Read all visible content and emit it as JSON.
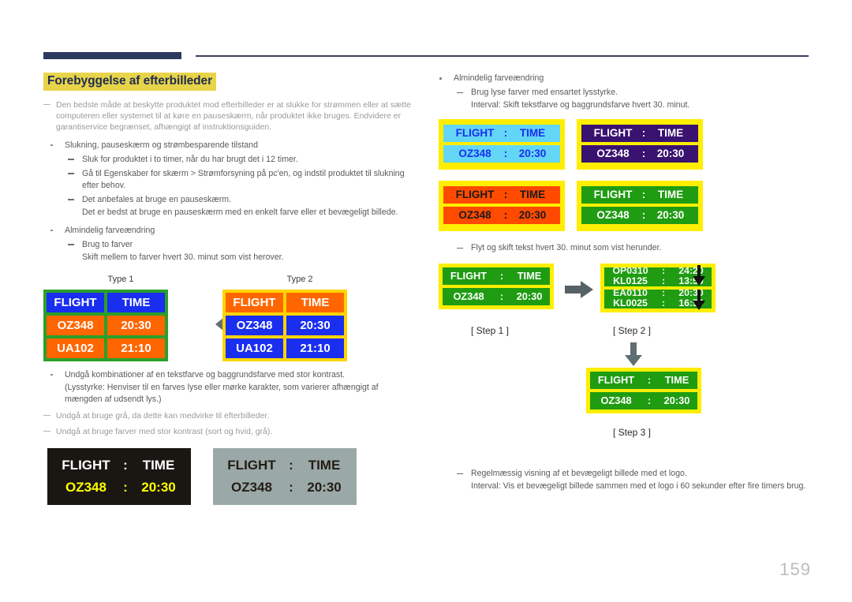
{
  "page": {
    "number": "159",
    "accent_navy": "#2b3a5c",
    "highlight_yellow": "#e8d44a"
  },
  "section": {
    "title": "Forebyggelse af efterbilleder"
  },
  "left": {
    "intro_note": "Den bedste måde at beskytte produktet mod efterbilleder er at slukke for strømmen eller at sætte computeren eller systemet til at køre en pauseskærm, når produktet ikke bruges. Endvidere er garantiservice begrænset, afhængigt af instruktionsguiden.",
    "bullet1": "Slukning, pauseskærm og strømbesparende tilstand",
    "sub1": "Sluk for produktet i to timer, når du har brugt det i 12 timer.",
    "sub2": "Gå til Egenskaber for skærm > Strømforsyning på pc'en, og indstil produktet til slukning efter behov.",
    "sub3": "Det anbefales at bruge en pauseskærm.",
    "sub3_cont": "Det er bedst at bruge en pauseskærm med en enkelt farve eller et bevægeligt billede.",
    "bullet2": "Almindelig farveændring",
    "sub4": "Brug to farver",
    "sub4_cont": "Skift mellem to farver hvert 30. minut som vist herover.",
    "bullet3": "Undgå kombinationer af en tekstfarve og baggrundsfarve med stor kontrast.",
    "bullet3_cont": "(Lysstyrke: Henviser til en farves lyse eller mørke karakter, som varierer afhængigt af mængden af udsendt lys.)",
    "note2": "Undgå at bruge grå, da dette kan medvirke til efterbilleder.",
    "note3": "Undgå at bruge farver med stor kontrast (sort og hvid, grå).",
    "type1_label": "Type 1",
    "type2_label": "Type 2",
    "swap_arrow_icon": "double-headed-arrow"
  },
  "right": {
    "bullet1": "Almindelig farveændring",
    "sub1": "Brug lyse farver med ensartet lysstyrke.",
    "sub1_cont": "Interval: Skift tekstfarve og baggrundsfarve hvert 30. minut.",
    "sub2": "Flyt og skift tekst hvert 30. minut som vist herunder.",
    "sub3": "Regelmæssig visning af et bevægeligt billede med et logo.",
    "sub3_cont": "Interval: Vis et bevægeligt billede sammen med et logo i 60 sekunder efter fire timers brug.",
    "step1_label": "[ Step 1 ]",
    "step2_label": "[ Step 2 ]",
    "step3_label": "[ Step 3 ]",
    "right_arrow_icon": "right-arrow",
    "down_arrow_icon": "down-arrow"
  },
  "boards": {
    "type1": {
      "border": "#2aa02a",
      "rows": [
        {
          "cells": [
            {
              "text": "FLIGHT",
              "bg": "#1a2ef0",
              "fg": "#ffffff"
            },
            {
              "text": "TIME",
              "bg": "#1a2ef0",
              "fg": "#ffffff"
            }
          ]
        },
        {
          "cells": [
            {
              "text": "OZ348",
              "bg": "#ff6600",
              "fg": "#ffffff"
            },
            {
              "text": "20:30",
              "bg": "#ff6600",
              "fg": "#ffffff"
            }
          ]
        },
        {
          "cells": [
            {
              "text": "UA102",
              "bg": "#ff6600",
              "fg": "#ffffff"
            },
            {
              "text": "21:10",
              "bg": "#ff6600",
              "fg": "#ffffff"
            }
          ]
        }
      ]
    },
    "type2": {
      "border": "#ffd400",
      "rows": [
        {
          "cells": [
            {
              "text": "FLIGHT",
              "bg": "#ff6600",
              "fg": "#ffffff"
            },
            {
              "text": "TIME",
              "bg": "#ff6600",
              "fg": "#ffffff"
            }
          ]
        },
        {
          "cells": [
            {
              "text": "OZ348",
              "bg": "#1a2ef0",
              "fg": "#ffffff"
            },
            {
              "text": "20:30",
              "bg": "#1a2ef0",
              "fg": "#ffffff"
            }
          ]
        },
        {
          "cells": [
            {
              "text": "UA102",
              "bg": "#1a2ef0",
              "fg": "#ffffff"
            },
            {
              "text": "21:10",
              "bg": "#1a2ef0",
              "fg": "#ffffff"
            }
          ]
        }
      ]
    },
    "sample_dark": {
      "bg": "#1a1612",
      "row1": {
        "a": "FLIGHT",
        "b": ":",
        "c": "TIME",
        "fg": "#ffffff"
      },
      "row2": {
        "a": "OZ348",
        "b": ":",
        "c": "20:30",
        "fg": "#ffff00"
      }
    },
    "sample_gray": {
      "bg": "#9aa9a8",
      "row1": {
        "a": "FLIGHT",
        "b": ":",
        "c": "TIME",
        "fg": "#241c14"
      },
      "row2": {
        "a": "OZ348",
        "b": ":",
        "c": "20:30",
        "fg": "#241c14"
      }
    },
    "quad": [
      {
        "border": "#ffee00",
        "bg": "#63d5f5",
        "fg": "#1a2ef0",
        "row1": {
          "a": "FLIGHT",
          "b": ":",
          "c": "TIME"
        },
        "row2": {
          "a": "OZ348",
          "b": ":",
          "c": "20:30"
        }
      },
      {
        "border": "#ffee00",
        "bg": "#3a1270",
        "fg": "#ffffff",
        "row1": {
          "a": "FLIGHT",
          "b": ":",
          "c": "TIME"
        },
        "row2": {
          "a": "OZ348",
          "b": ":",
          "c": "20:30"
        }
      },
      {
        "border": "#ffee00",
        "bg": "#ff4a00",
        "fg": "#1a1a1a",
        "row1": {
          "a": "FLIGHT",
          "b": ":",
          "c": "TIME"
        },
        "row2": {
          "a": "OZ348",
          "b": ":",
          "c": "20:30"
        }
      },
      {
        "border": "#ffee00",
        "bg": "#1f9c12",
        "fg": "#ffffff",
        "row1": {
          "a": "FLIGHT",
          "b": ":",
          "c": "TIME"
        },
        "row2": {
          "a": "OZ348",
          "b": ":",
          "c": "20:30"
        }
      }
    ],
    "step1": {
      "row1": {
        "a": "FLIGHT",
        "b": ":",
        "c": "TIME"
      },
      "row2": {
        "a": "OZ348",
        "b": ":",
        "c": "20:30"
      }
    },
    "step2": {
      "row1_top": {
        "a": "OP0310",
        "b": ":",
        "c": "24:20"
      },
      "row1_bottom": {
        "a": "KL0125",
        "b": ":",
        "c": "13:50"
      },
      "row2_top": {
        "a": "EA0110",
        "b": ":",
        "c": "20:30"
      },
      "row2_bottom": {
        "a": "KL0025",
        "b": ":",
        "c": "16:50"
      }
    },
    "step3": {
      "row1": {
        "a": "FLIGHT",
        "b": ":",
        "c": "TIME"
      },
      "row2": {
        "a": "OZ348",
        "b": ":",
        "c": "20:30"
      }
    }
  }
}
